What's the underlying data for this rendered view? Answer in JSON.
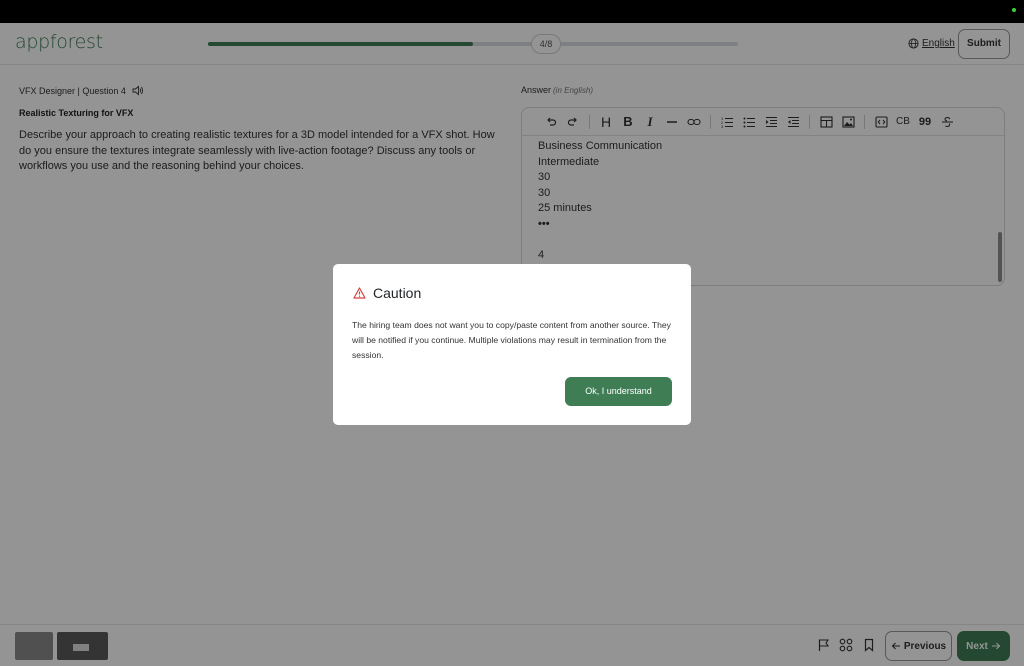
{
  "header": {
    "logo": "appforest",
    "progress_label": "4/8",
    "progress_fraction": 0.5,
    "language": "English",
    "submit_label": "Submit"
  },
  "question": {
    "meta": "VFX Designer | Question 4",
    "title": "Realistic Texturing for VFX",
    "text": "Describe your approach to creating realistic textures for a 3D model intended for a VFX shot. How do you ensure the textures integrate seamlessly with live-action footage? Discuss any tools or workflows you use and the reasoning behind your choices."
  },
  "answer": {
    "label": "Answer",
    "label_note": "(in English)",
    "lines": [
      "Business Communication",
      "Intermediate",
      "30",
      "30",
      "25 minutes",
      "•••",
      "",
      "4"
    ],
    "toolbar": {
      "code_block_label": "CB",
      "quote_label": "99",
      "heading_label": "H",
      "bold_label": "B",
      "italic_label": "I"
    }
  },
  "footer": {
    "previous_label": "Previous",
    "next_label": "Next"
  },
  "modal": {
    "title": "Caution",
    "body": "The hiring team does not want you to copy/paste content from another source. They will be notified if you continue. Multiple violations may result in termination from the session.",
    "button_label": "Ok, I understand"
  },
  "colors": {
    "brand_green": "#3f7d55",
    "warning_red": "#d14545"
  }
}
